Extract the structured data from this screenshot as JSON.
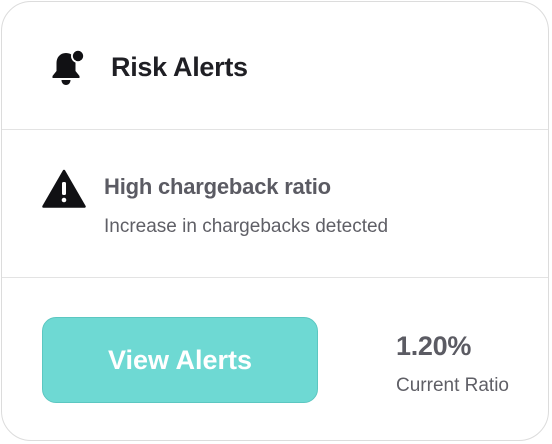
{
  "header": {
    "icon": "bell-alert-icon",
    "title": "Risk Alerts"
  },
  "alert": {
    "icon": "warning-triangle-icon",
    "title": "High chargeback ratio",
    "description": "Increase in chargebacks detected"
  },
  "footer": {
    "button_label": "View Alerts",
    "ratio_value": "1.20%",
    "ratio_label": "Current Ratio"
  },
  "colors": {
    "accent": "#6ed9d3",
    "title_text": "#1f1f24",
    "muted_text": "#5b5b63"
  }
}
